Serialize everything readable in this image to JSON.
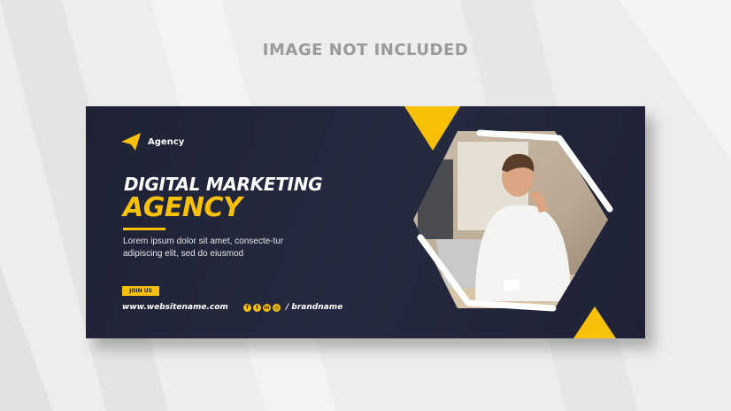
{
  "watermark": "IMAGE NOT INCLUDED",
  "brand": {
    "name": "Agency"
  },
  "headline": {
    "line1": "DIGITAL MARKETING",
    "line2": "AGENCY"
  },
  "description": "Lorem ipsum dolor sit amet, consecte-tur adipiscing elit, sed do eiusmod",
  "cta": {
    "label": "JOIN US"
  },
  "footer": {
    "website": "www.websitename.com",
    "brandname": "/ brandname",
    "social_icons": [
      "facebook-icon",
      "twitter-icon",
      "linkedin-icon",
      "instagram-icon"
    ]
  },
  "colors": {
    "accent": "#f8c109",
    "banner_bg": "#22253a",
    "page_bg": "#ededed"
  }
}
